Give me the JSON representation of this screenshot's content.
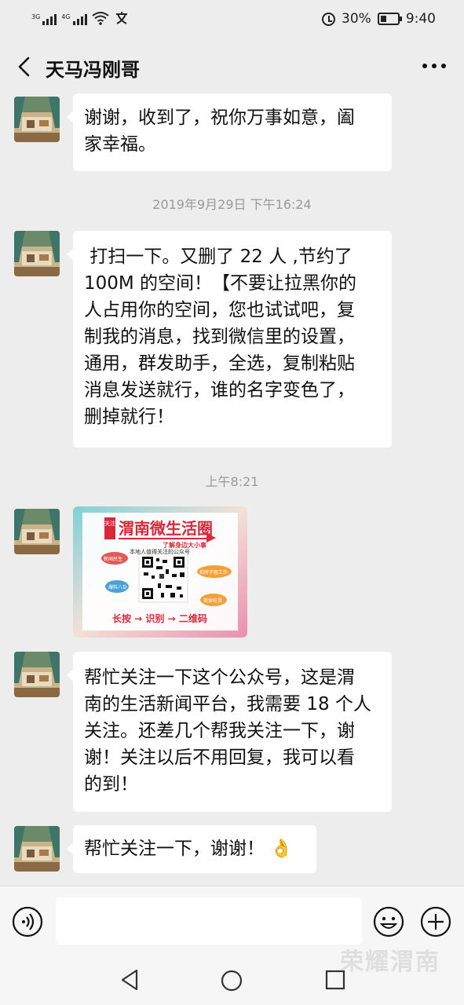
{
  "status_bar": {
    "sim1_label": "3G",
    "sim2_label": "4G",
    "battery_percent": "30%",
    "time": "9:40"
  },
  "header": {
    "title": "天马冯刚哥"
  },
  "messages": [
    {
      "type": "text",
      "text_line1": "谢谢，收到了，祝你万事如意，阖",
      "text_line2": "家幸福。"
    },
    {
      "type": "timestamp",
      "text": "2019年9月29日 下午16:24"
    },
    {
      "type": "text",
      "lines": [
        " 打扫一下。又删了 22 人 ,节约了",
        "100M 的空间！【不要让拉黑你的",
        "人占用你的空间，您也试试吧，复",
        "制我的消息，找到微信里的设置，",
        "通用，群发助手，全选，复制粘贴",
        "消息发送就行，谁的名字变色了，",
        "删掉就行！"
      ]
    },
    {
      "type": "timestamp",
      "text": "上午8:21"
    },
    {
      "type": "image",
      "poster": {
        "badge": "关注",
        "title": "渭南微生活圈",
        "subtitle": "了解身边大小事",
        "tagline": "本地人值得关注的公众号",
        "tags": [
          "新闻民生",
          "拍房子租工作",
          "爆料八卦",
          "美食吃货"
        ],
        "footer": "长按 → 识别 → 二维码"
      }
    },
    {
      "type": "text",
      "lines": [
        "帮忙关注一下这个公众号，这是渭",
        "南的生活新闻平台，我需要 18 个人",
        "关注。还差几个帮我关注一下，谢",
        "谢！关注以后不用回复，我可以看",
        "的到！"
      ]
    },
    {
      "type": "text",
      "text": "帮忙关注一下，谢谢！",
      "emoji": "👌"
    }
  ],
  "input_bar": {
    "placeholder": ""
  },
  "watermark": "荣耀渭南",
  "colors": {
    "background": "#ededed",
    "bubble": "#ffffff",
    "timestamp": "#9a9a9a",
    "poster_red": "#d8283a"
  }
}
